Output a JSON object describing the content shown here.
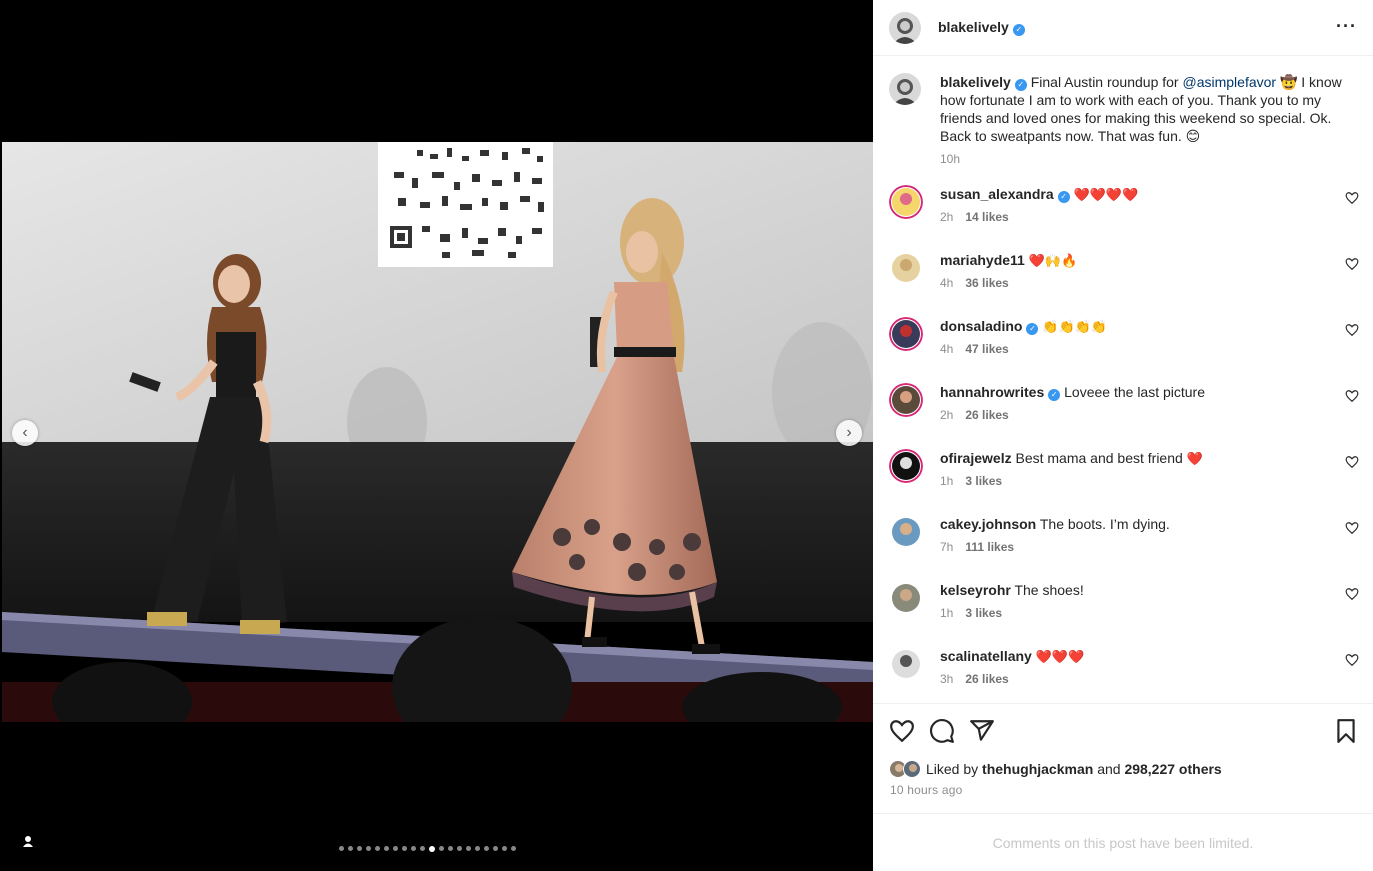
{
  "post": {
    "author": "blakelively",
    "menu_icon": "more-horizontal-icon"
  },
  "caption": {
    "author": "blakelively",
    "text_before": " Final Austin roundup for ",
    "mention": "@asimplefavor",
    "text_after": " 🤠 I know how fortunate I am to work with each of you. Thank you to my friends and loved ones for making this weekend so special. Ok. Back to sweatpants now. That was fun. 😊",
    "time": "10h"
  },
  "comments": [
    {
      "user": "susan_alexandra",
      "verified": true,
      "text": "",
      "emoji": "❤️❤️❤️❤️",
      "time": "2h",
      "likes": "14 likes"
    },
    {
      "user": "mariahyde11",
      "verified": false,
      "text": "",
      "emoji": "❤️🙌🔥",
      "time": "4h",
      "likes": "36 likes"
    },
    {
      "user": "donsaladino",
      "verified": true,
      "text": "",
      "emoji": "👏👏👏👏",
      "time": "4h",
      "likes": "47 likes"
    },
    {
      "user": "hannahrowrites",
      "verified": true,
      "text": "Loveee the last picture",
      "emoji": "",
      "time": "2h",
      "likes": "26 likes"
    },
    {
      "user": "ofirajewelz",
      "verified": false,
      "text": "Best mama and best friend",
      "emoji": "❤️",
      "time": "1h",
      "likes": "3 likes"
    },
    {
      "user": "cakey.johnson",
      "verified": false,
      "text": "The boots. I’m dying.",
      "emoji": "",
      "time": "7h",
      "likes": "111 likes"
    },
    {
      "user": "kelseyrohr",
      "verified": false,
      "text": "The shoes!",
      "emoji": "",
      "time": "1h",
      "likes": "3 likes"
    },
    {
      "user": "scalinatellany",
      "verified": false,
      "text": "",
      "emoji": "❤️❤️❤️",
      "time": "3h",
      "likes": "26 likes"
    }
  ],
  "likes": {
    "prefix": "Liked by",
    "user": "thehughjackman",
    "and": "and",
    "others": "298,227 others",
    "time_ago": "10 hours ago"
  },
  "footer": {
    "limited": "Comments on this post have been limited."
  },
  "carousel": {
    "total_slides": 20,
    "active_index": 10
  },
  "colors": {
    "verified": "#3897f0",
    "mention": "#00376b",
    "meta": "#8e8e8e",
    "limited": "#c7c7c7"
  }
}
